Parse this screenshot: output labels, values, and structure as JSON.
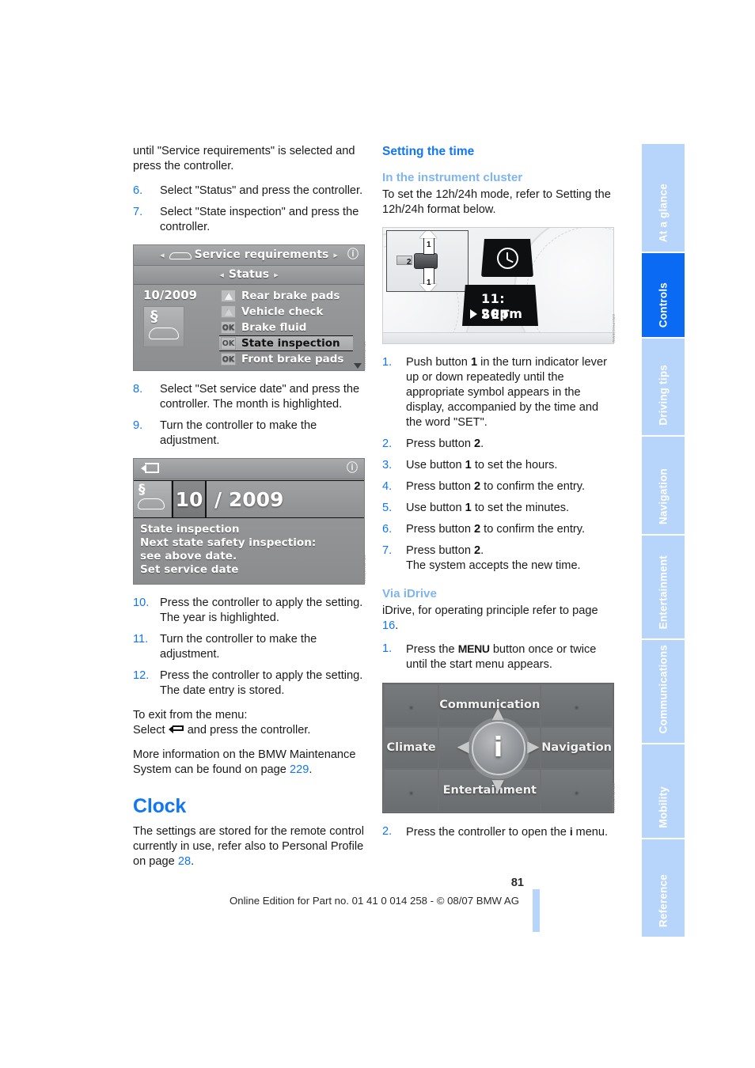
{
  "page": {
    "number": "81",
    "footer_text": "Online Edition for Part no. 01 41 0 014 258 - © 08/07 BMW AG"
  },
  "sidebar": {
    "tabs": [
      {
        "label": "At a glance",
        "active": false
      },
      {
        "label": "Controls",
        "active": true
      },
      {
        "label": "Driving tips",
        "active": false
      },
      {
        "label": "Navigation",
        "active": false
      },
      {
        "label": "Entertainment",
        "active": false
      },
      {
        "label": "Communications",
        "active": false
      },
      {
        "label": "Mobility",
        "active": false
      },
      {
        "label": "Reference",
        "active": false
      }
    ]
  },
  "left_column": {
    "intro": "until \"Service requirements\" is selected and press the controller.",
    "steps_a": [
      {
        "num": "6.",
        "text": "Select \"Status\" and press the controller."
      },
      {
        "num": "7.",
        "text": "Select \"State inspection\" and press the controller."
      }
    ],
    "figure_status": {
      "title": "Service requirements",
      "subtitle": "Status",
      "date": "10/2009",
      "rows": [
        {
          "badge": "warn",
          "label": "Rear brake pads",
          "selected": false
        },
        {
          "badge": "warn2",
          "label": "Vehicle check",
          "selected": false
        },
        {
          "badge": "OK",
          "label": "Brake fluid",
          "selected": false
        },
        {
          "badge": "OK",
          "label": "State inspection",
          "selected": true
        },
        {
          "badge": "OK",
          "label": "Front brake pads",
          "selected": false
        }
      ],
      "code": "GRAPHIC/BMW"
    },
    "steps_b": [
      {
        "num": "8.",
        "text": "Select \"Set service date\" and press the controller. The month is highlighted."
      },
      {
        "num": "9.",
        "text": "Turn the controller to make the adjustment."
      }
    ],
    "figure_date": {
      "month": "10",
      "year": "/ 2009",
      "lines": [
        "State inspection",
        "Next state safety inspection:",
        "see above date.",
        "Set service date"
      ],
      "code": "GRAPHIC/BMW"
    },
    "steps_c": [
      {
        "num": "10.",
        "text": "Press the controller to apply the setting. The year is highlighted."
      },
      {
        "num": "11.",
        "text": "Turn the controller to make the adjustment."
      },
      {
        "num": "12.",
        "text": "Press the controller to apply the setting. The date entry is stored."
      }
    ],
    "exit_line1": "To exit from the menu:",
    "exit_line2_pre": "Select",
    "exit_line2_post": "and press the controller.",
    "more_info_pre": "More information on the BMW Maintenance System can be found on page",
    "more_info_page": "229",
    "more_info_post": ".",
    "clock_heading": "Clock",
    "clock_body_pre": "The settings are stored for the remote control currently in use, refer also to Personal Profile on page",
    "clock_body_page": "28",
    "clock_body_post": "."
  },
  "right_column": {
    "heading": "Setting the time",
    "sub_cluster": "In the instrument cluster",
    "cluster_intro": "To set the 12h/24h mode, refer to Setting the 12h/24h format below.",
    "figure_cluster": {
      "label_1_top": "1",
      "label_1_bottom": "1",
      "label_2": "2",
      "time": "11: 20pm",
      "set": "SET",
      "code": "GRAPHIC/BMW"
    },
    "cluster_steps": [
      {
        "num": "1.",
        "parts": [
          "Push button ",
          "1",
          " in the turn indicator lever up or down repeatedly until the appropriate symbol appears in the display, accompanied by the time and the word \"SET\"."
        ]
      },
      {
        "num": "2.",
        "parts": [
          "Press button ",
          "2",
          "."
        ]
      },
      {
        "num": "3.",
        "parts": [
          "Use button ",
          "1",
          " to set the hours."
        ]
      },
      {
        "num": "4.",
        "parts": [
          "Press button ",
          "2",
          " to confirm the entry."
        ]
      },
      {
        "num": "5.",
        "parts": [
          "Use button ",
          "1",
          " to set the minutes."
        ]
      },
      {
        "num": "6.",
        "parts": [
          "Press button ",
          "2",
          " to confirm the entry."
        ]
      },
      {
        "num": "7.",
        "parts": [
          "Press button ",
          "2",
          ".\nThe system accepts the new time."
        ]
      }
    ],
    "sub_idrive": "Via iDrive",
    "idrive_intro_pre": "iDrive, for operating principle refer to page",
    "idrive_intro_page": "16",
    "idrive_intro_post": ".",
    "idrive_step1_pre": "Press the",
    "idrive_step1_key": "MENU",
    "idrive_step1_post": "button once or twice until the start menu appears.",
    "idrive_step1_num": "1.",
    "figure_startmenu": {
      "top": "Communication",
      "left": "Climate",
      "right": "Navigation",
      "bottom": "Entertainment",
      "center": "i",
      "code": "GRAPHIC/BMW"
    },
    "idrive_step2_num": "2.",
    "idrive_step2_pre": "Press the controller to open the",
    "idrive_step2_key": "i",
    "idrive_step2_post": "menu."
  },
  "colors": {
    "accent": "#1176f5",
    "tab_inactive": "#b7d4fa",
    "tab_active": "#0a6af4"
  }
}
